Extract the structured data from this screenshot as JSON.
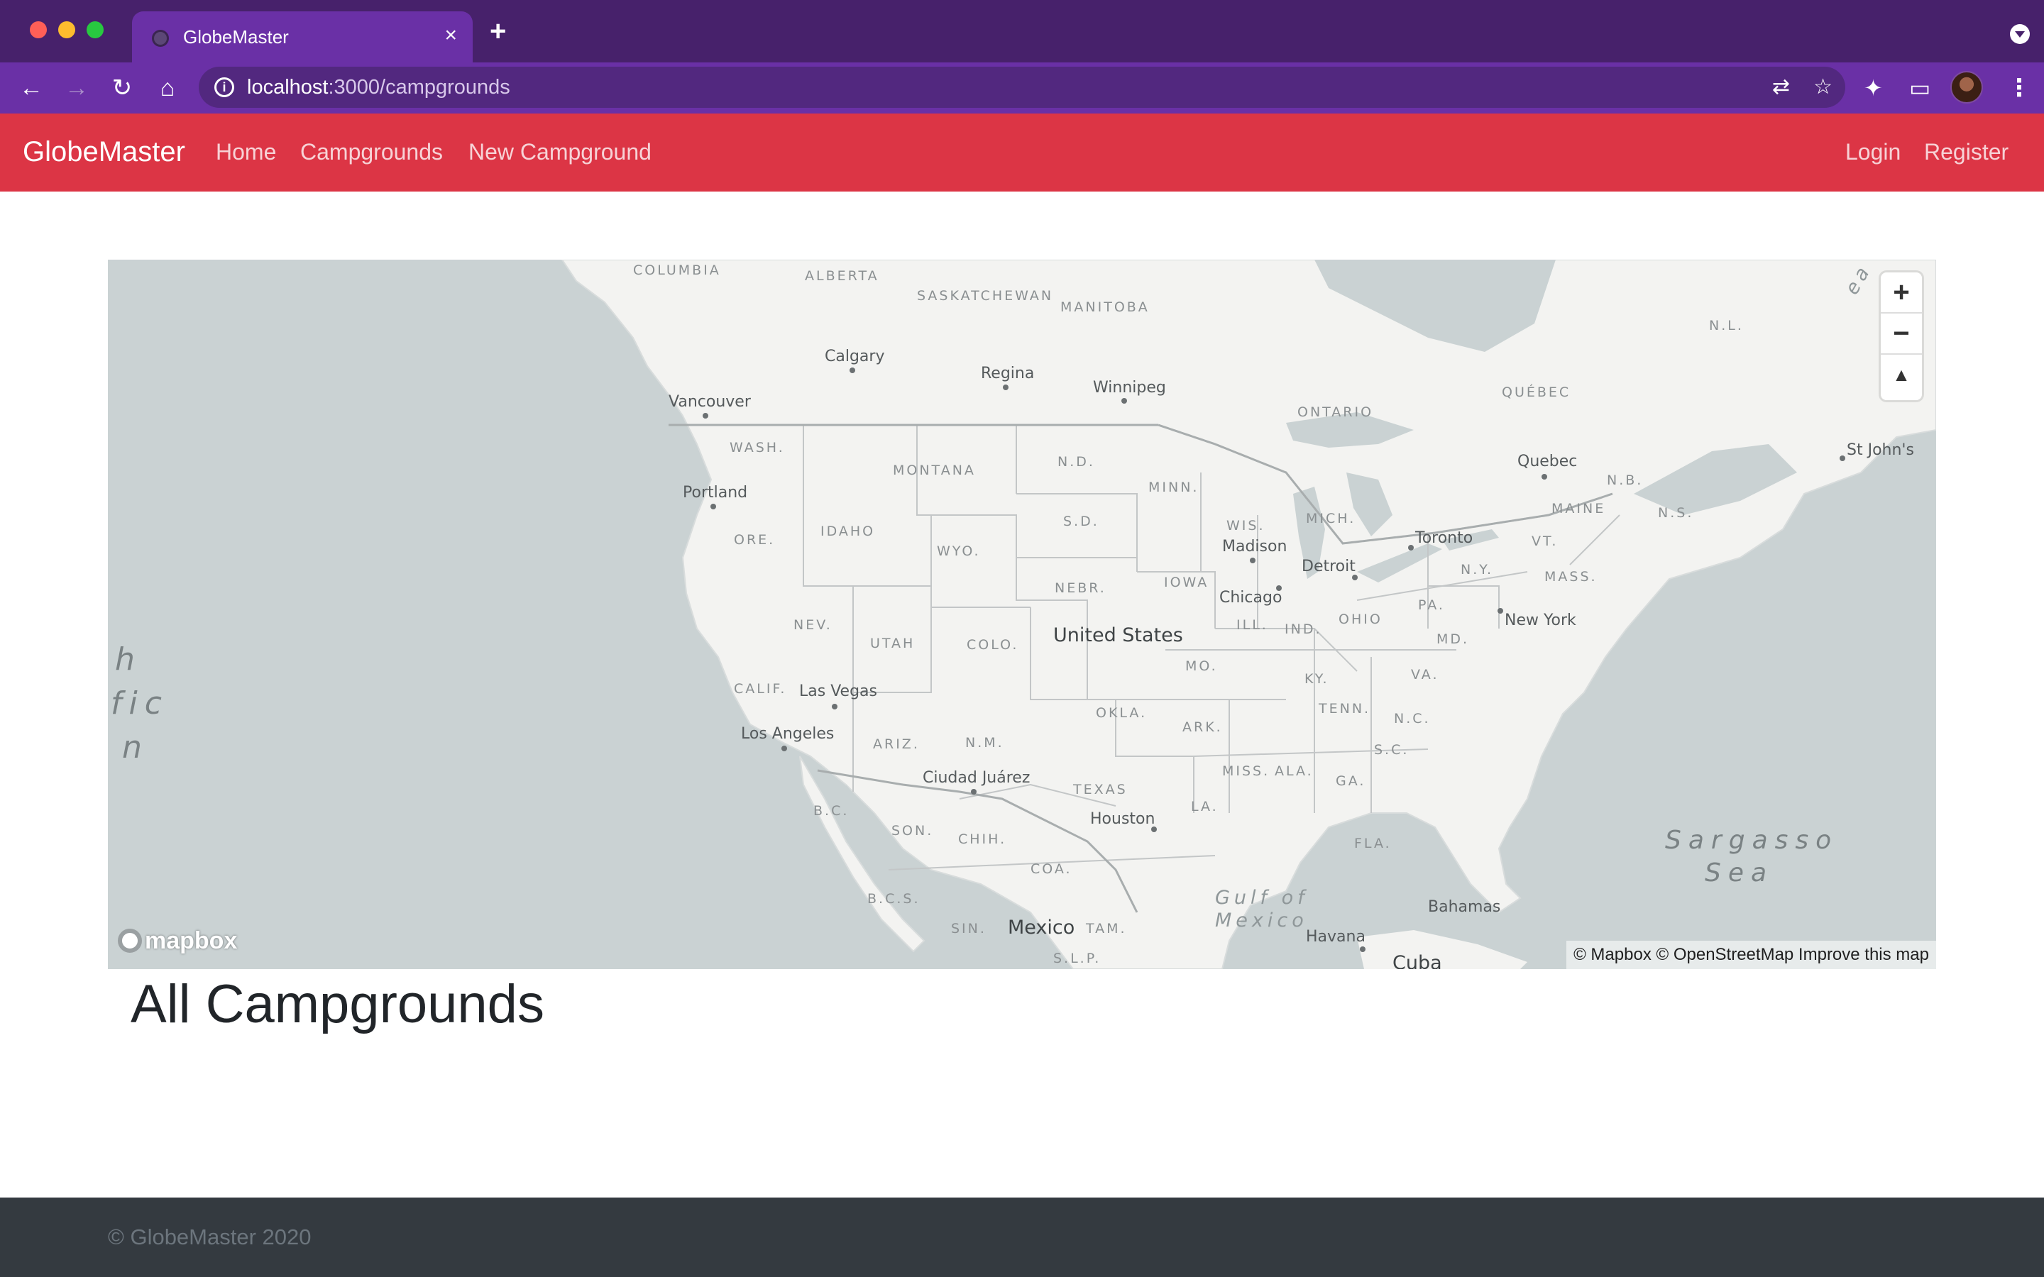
{
  "browser": {
    "tab_title": "GlobeMaster",
    "tab_close": "×",
    "new_tab": "+",
    "url_host": "localhost",
    "url_path": ":3000/campgrounds",
    "info_glyph": "i",
    "back_glyph": "←",
    "forward_glyph": "→",
    "reload_glyph": "↻",
    "home_glyph": "⌂",
    "translate_glyph": "⇄",
    "star_glyph": "☆",
    "extensions_glyph": "✦",
    "cast_glyph": "▭",
    "menu_glyph": "⋮",
    "colors": {
      "frame": "#47216b",
      "toolbar": "#6a30a6",
      "omnibox": "#52287f"
    }
  },
  "navbar": {
    "brand": "GlobeMaster",
    "links": [
      "Home",
      "Campgrounds",
      "New Campground"
    ],
    "right_links": [
      "Login",
      "Register"
    ],
    "color": "#dc3545"
  },
  "map": {
    "states": [
      "WASH.",
      "ORE.",
      "IDAHO",
      "MONTANA",
      "WYO.",
      "NEV.",
      "UTAH",
      "COLO.",
      "CALIF.",
      "ARIZ.",
      "N.M.",
      "N.D.",
      "S.D.",
      "NEBR.",
      "MINN.",
      "IOWA",
      "WIS.",
      "MICH.",
      "ILL.",
      "IND.",
      "OHIO",
      "PA.",
      "N.Y.",
      "VT.",
      "MASS.",
      "MAINE",
      "N.B.",
      "N.S.",
      "MO.",
      "KY.",
      "VA.",
      "MD.",
      "TENN.",
      "N.C.",
      "S.C.",
      "OKLA.",
      "ARK.",
      "TEXAS",
      "MISS.",
      "ALA.",
      "GA.",
      "LA.",
      "FLA.",
      "COLUMBIA",
      "ALBERTA",
      "SASKATCHEWAN",
      "MANITOBA",
      "ONTARIO",
      "QUÉBEC",
      "N.L.",
      "B.C.",
      "SON.",
      "CHIH.",
      "COA.",
      "B.C.S.",
      "SIN.",
      "TAM.",
      "S.L.P."
    ],
    "cities": [
      "Calgary",
      "Regina",
      "Winnipeg",
      "Vancouver",
      "Portland",
      "Madison",
      "Toronto",
      "Detroit",
      "Chicago",
      "Quebec",
      "St John's",
      "New York",
      "Las Vegas",
      "Los Angeles",
      "Ciudad Juárez",
      "Houston",
      "Havana",
      "Bahamas"
    ],
    "country": "United States",
    "country_mexico": "Mexico",
    "cuba": "Cuba",
    "gulf": [
      "Gulf of",
      "Mexico"
    ],
    "sargasso": [
      "Sargasso",
      "Sea"
    ],
    "ocean_fragments": [
      "h",
      "fic",
      "n"
    ],
    "sea_fragment": "ea",
    "zoom_in": "+",
    "zoom_out": "−",
    "compass": "▲",
    "logo": "mapbox",
    "attribution": "© Mapbox © OpenStreetMap Improve this map",
    "colors": {
      "water": "#cad2d3",
      "land": "#f3f3f1",
      "border": "#c3c6c7"
    }
  },
  "heading": "All Campgrounds",
  "footer": "© GlobeMaster 2020"
}
